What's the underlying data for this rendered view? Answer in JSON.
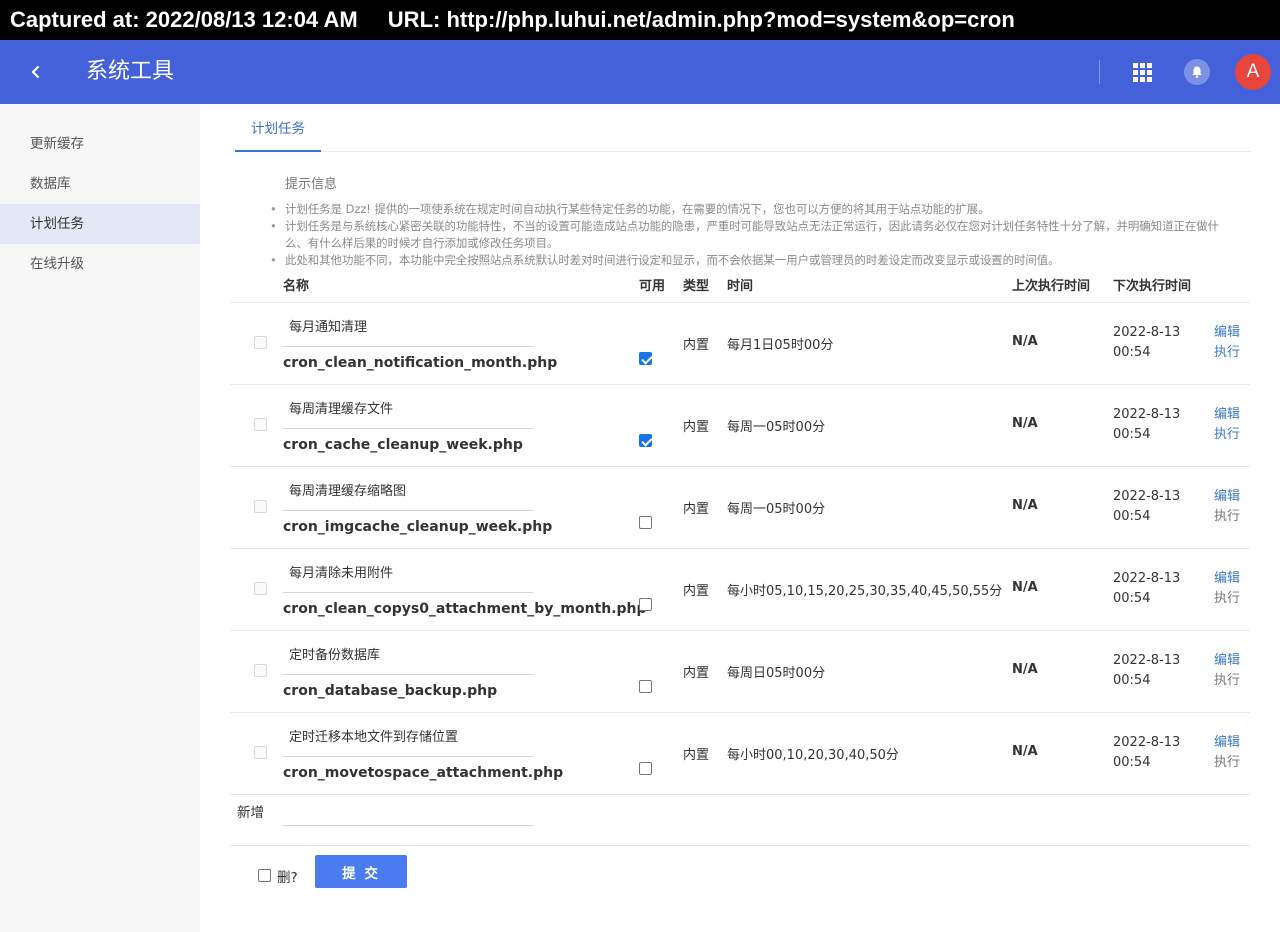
{
  "capture": {
    "captured_at": "Captured at: 2022/08/13 12:04 AM",
    "url": "URL: http://php.luhui.net/admin.php?mod=system&op=cron"
  },
  "header": {
    "back_icon": "chevron-left-icon",
    "title": "系统工具",
    "apps_icon": "grid-icon",
    "bell_icon": "bell-icon",
    "avatar_letter": "A",
    "colors": {
      "bar": "#4461d9",
      "avatar": "#e8453c"
    }
  },
  "sidebar": {
    "items": [
      {
        "label": "更新缓存",
        "active": false
      },
      {
        "label": "数据库",
        "active": false
      },
      {
        "label": "计划任务",
        "active": true
      },
      {
        "label": "在线升级",
        "active": false
      }
    ]
  },
  "tabs": [
    {
      "label": "计划任务",
      "active": true
    }
  ],
  "tips": {
    "title": "提示信息",
    "items": [
      "计划任务是 Dzz! 提供的一项使系统在规定时间自动执行某些特定任务的功能，在需要的情况下，您也可以方便的将其用于站点功能的扩展。",
      "计划任务是与系统核心紧密关联的功能特性，不当的设置可能造成站点功能的隐患，严重时可能导致站点无法正常运行，因此请务必仅在您对计划任务特性十分了解，并明确知道正在做什么、有什么样后果的时候才自行添加或修改任务项目。",
      "此处和其他功能不同，本功能中完全按照站点系统默认时差对时间进行设定和显示，而不会依据某一用户或管理员的时差设定而改变显示或设置的时间值。"
    ]
  },
  "table": {
    "headers": {
      "name": "名称",
      "enabled": "可用",
      "type": "类型",
      "time": "时间",
      "last_run": "上次执行时间",
      "next_run": "下次执行时间"
    },
    "rows": [
      {
        "cn_name": "每月通知清理",
        "filename": "cron_clean_notification_month.php",
        "enabled": true,
        "type": "内置",
        "time": "每月1日05时00分",
        "last": "N/A",
        "next_date": "2022-8-13",
        "next_time": "00:54",
        "edit": "编辑",
        "run": "执行",
        "run_active": true
      },
      {
        "cn_name": "每周清理缓存文件",
        "filename": "cron_cache_cleanup_week.php",
        "enabled": true,
        "type": "内置",
        "time": "每周一05时00分",
        "last": "N/A",
        "next_date": "2022-8-13",
        "next_time": "00:54",
        "edit": "编辑",
        "run": "执行",
        "run_active": true
      },
      {
        "cn_name": "每周清理缓存缩略图",
        "filename": "cron_imgcache_cleanup_week.php",
        "enabled": false,
        "type": "内置",
        "time": "每周一05时00分",
        "last": "N/A",
        "next_date": "2022-8-13",
        "next_time": "00:54",
        "edit": "编辑",
        "run": "执行",
        "run_active": false
      },
      {
        "cn_name": "每月清除未用附件",
        "filename": "cron_clean_copys0_attachment_by_month.php",
        "enabled": false,
        "type": "内置",
        "time": "每小时05,10,15,20,25,30,35,40,45,50,55分",
        "last": "N/A",
        "next_date": "2022-8-13",
        "next_time": "00:54",
        "edit": "编辑",
        "run": "执行",
        "run_active": false
      },
      {
        "cn_name": "定时备份数据库",
        "filename": "cron_database_backup.php",
        "enabled": false,
        "type": "内置",
        "time": "每周日05时00分",
        "last": "N/A",
        "next_date": "2022-8-13",
        "next_time": "00:54",
        "edit": "编辑",
        "run": "执行",
        "run_active": false
      },
      {
        "cn_name": "定时迁移本地文件到存储位置",
        "filename": "cron_movetospace_attachment.php",
        "enabled": false,
        "type": "内置",
        "time": "每小时00,10,20,30,40,50分",
        "last": "N/A",
        "next_date": "2022-8-13",
        "next_time": "00:54",
        "edit": "编辑",
        "run": "执行",
        "run_active": false
      }
    ]
  },
  "new_row": {
    "label": "新增",
    "value": "",
    "placeholder": ""
  },
  "footer": {
    "delete_label": "删?",
    "delete_checked": false,
    "submit_label": "提 交"
  }
}
